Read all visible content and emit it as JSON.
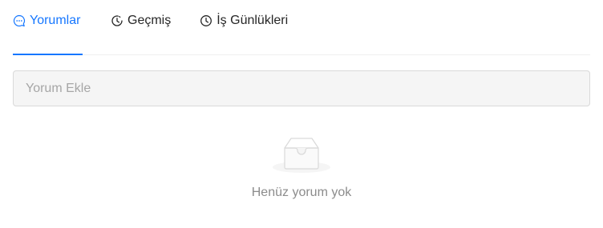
{
  "tabs": [
    {
      "label": "Yorumlar",
      "icon": "comment-icon",
      "active": true
    },
    {
      "label": "Geçmiş",
      "icon": "history-icon",
      "active": false
    },
    {
      "label": "İş Günlükleri",
      "icon": "clock-icon",
      "active": false
    }
  ],
  "comment_input": {
    "placeholder": "Yorum Ekle",
    "value": ""
  },
  "empty_state": {
    "icon": "empty-inbox-icon",
    "text": "Henüz yorum yok"
  },
  "colors": {
    "accent": "#1677ff",
    "text": "#262626",
    "muted": "#8c8c8c",
    "input_bg": "#f5f5f5",
    "border": "#d9d9d9"
  }
}
